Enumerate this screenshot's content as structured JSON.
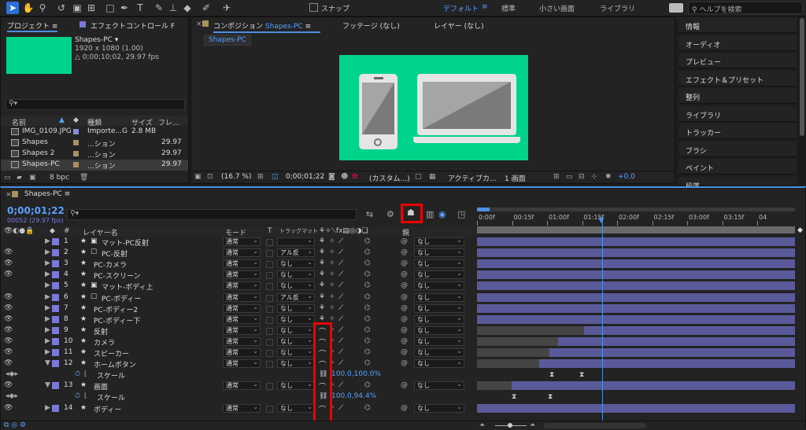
{
  "toolbar": {
    "snap_label": "スナップ",
    "workspaces": [
      "デフォルト",
      "標準",
      "小さい画面",
      "ライブラリ"
    ],
    "search_placeholder": "ヘルプを検索",
    "menu_icon": "≡"
  },
  "project": {
    "tab": "プロジェクト",
    "tab2": "エフェクトコントロール F",
    "name": "Shapes-PC ▾",
    "res": "1920 x 1080 (1.00)",
    "dur": "△ 0;00;10;02, 29.97 fps",
    "thumb_color": "#00d48a",
    "headers": [
      "名前",
      "種類",
      "サイズ",
      "フレ..."
    ],
    "items": [
      {
        "name": "IMG_0109.JPG",
        "type": "Importe...G",
        "size": "2.8 MB",
        "fps": ""
      },
      {
        "name": "Shapes",
        "type": "...ション",
        "size": "",
        "fps": "29.97"
      },
      {
        "name": "Shapes 2",
        "type": "...ション",
        "size": "",
        "fps": "29.97"
      },
      {
        "name": "Shapes-PC",
        "type": "...ション",
        "size": "",
        "fps": "29.97"
      }
    ],
    "bpc": "8 bpc"
  },
  "viewer": {
    "tab_comp_prefix": "コンポジション",
    "tab_comp_name": "Shapes-PC",
    "tab_footage": "フッテージ (なし)",
    "tab_layer": "レイヤー (なし)",
    "comp_chip": "Shapes-PC",
    "zoom": "(16.7 %)",
    "timecode": "0;00;01;22",
    "custom": "(カスタム...)",
    "active": "アクティブカ...",
    "views": "1 画面",
    "exposure": "+0.0",
    "bg_color": "#00d48a"
  },
  "right_panel": {
    "items": [
      "情報",
      "オーディオ",
      "プレビュー",
      "エフェクト＆プリセット",
      "整列",
      "ライブラリ",
      "トラッカー",
      "ブラシ",
      "ペイント",
      "段落"
    ]
  },
  "timeline": {
    "tab": "Shapes-PC",
    "timecode": "0;00;01;22",
    "fps_info": "00052 (29.97 fps)",
    "headers": {
      "num": "#",
      "name": "レイヤー名",
      "mode": "モード",
      "t": "T",
      "track": "トラックマット",
      "parent": "親"
    },
    "ruler": [
      "0:00f",
      "00:15f",
      "01:00f",
      "01:15f",
      "02:00f",
      "02:15f",
      "03:00f",
      "03:15f",
      "04"
    ],
    "layers": [
      {
        "n": "1",
        "name": "マット-PC反射",
        "mode": "通常",
        "track": "",
        "par": "なし",
        "color": "#7b79d8",
        "kind": "matte"
      },
      {
        "n": "2",
        "name": "PC-反射",
        "mode": "通常",
        "track": "アル反",
        "par": "なし",
        "color": "#7b79d8",
        "kind": "box"
      },
      {
        "n": "3",
        "name": "PC-カメラ",
        "mode": "通常",
        "track": "なし",
        "par": "なし",
        "color": "#7b79d8",
        "kind": "star"
      },
      {
        "n": "4",
        "name": "PC-スクリーン",
        "mode": "通常",
        "track": "なし",
        "par": "なし",
        "color": "#7b79d8",
        "kind": "star"
      },
      {
        "n": "5",
        "name": "マット-ボディ上",
        "mode": "通常",
        "track": "なし",
        "par": "なし",
        "color": "#7b79d8",
        "kind": "matte"
      },
      {
        "n": "6",
        "name": "PC-ボディー",
        "mode": "通常",
        "track": "アル反",
        "par": "なし",
        "color": "#7b79d8",
        "kind": "box"
      },
      {
        "n": "7",
        "name": "PC-ボディー2",
        "mode": "通常",
        "track": "なし",
        "par": "なし",
        "color": "#7b79d8",
        "kind": "star"
      },
      {
        "n": "8",
        "name": "PC-ボディー下",
        "mode": "通常",
        "track": "なし",
        "par": "なし",
        "color": "#7b79d8",
        "kind": "star"
      },
      {
        "n": "9",
        "name": "反射",
        "mode": "通常",
        "track": "なし",
        "par": "なし",
        "color": "#7b79d8",
        "kind": "star"
      },
      {
        "n": "10",
        "name": "カメラ",
        "mode": "通常",
        "track": "なし",
        "par": "なし",
        "color": "#7b79d8",
        "kind": "star"
      },
      {
        "n": "11",
        "name": "スピーカー",
        "mode": "通常",
        "track": "なし",
        "par": "なし",
        "color": "#7b79d8",
        "kind": "star"
      },
      {
        "n": "12",
        "name": "ホームボタン",
        "mode": "通常",
        "track": "なし",
        "par": "なし",
        "color": "#7b79d8",
        "kind": "star"
      },
      {
        "n": "",
        "name": "スケール",
        "prop_val": "100.0,100.0%",
        "kind": "prop"
      },
      {
        "n": "13",
        "name": "画面",
        "mode": "通常",
        "track": "なし",
        "par": "なし",
        "color": "#7b79d8",
        "kind": "star"
      },
      {
        "n": "",
        "name": "スケール",
        "prop_val": "100.0,94.4%",
        "kind": "prop"
      },
      {
        "n": "14",
        "name": "ボディー",
        "mode": "通常",
        "track": "なし",
        "par": "なし",
        "color": "#7b79d8",
        "kind": "star"
      }
    ]
  }
}
